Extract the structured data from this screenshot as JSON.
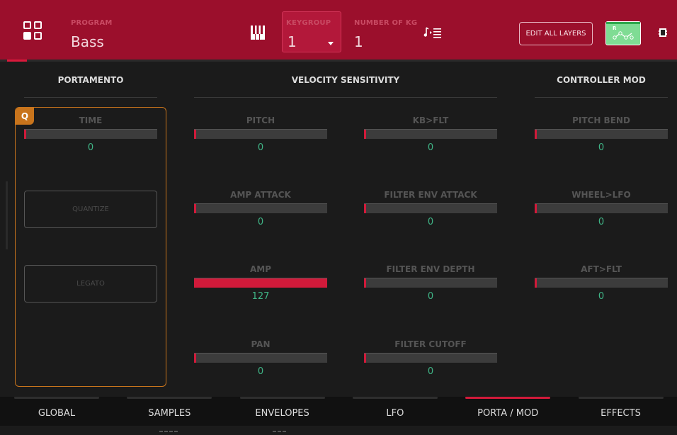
{
  "header": {
    "program_label": "PROGRAM",
    "program_value": "Bass",
    "keygroup_label": "KEYGROUP",
    "keygroup_value": "1",
    "number_of_kg_label": "NUMBER OF KG",
    "number_of_kg_value": "1",
    "edit_all_layers": "EDIT ALL LAYERS",
    "mod_matrix_letter": "R"
  },
  "sections": {
    "portamento": "PORTAMENTO",
    "velocity": "VELOCITY SENSITIVITY",
    "controller": "CONTROLLER MOD"
  },
  "portamento": {
    "q_badge": "Q",
    "time_label": "TIME",
    "time_value": "0",
    "quantize": "QUANTIZE",
    "legato": "LEGATO"
  },
  "params": [
    {
      "label": "PITCH",
      "value": "0",
      "level": 0
    },
    {
      "label": "AMP ATTACK",
      "value": "0",
      "level": 0
    },
    {
      "label": "AMP",
      "value": "127",
      "level": 1
    },
    {
      "label": "PAN",
      "value": "0",
      "level": 0
    },
    {
      "label": "KB>FLT",
      "value": "0",
      "level": 0
    },
    {
      "label": "FILTER ENV ATTACK",
      "value": "0",
      "level": 0
    },
    {
      "label": "FILTER ENV DEPTH",
      "value": "0",
      "level": 0
    },
    {
      "label": "FILTER CUTOFF",
      "value": "0",
      "level": 0
    },
    {
      "label": "PITCH BEND",
      "value": "0",
      "level": 0
    },
    {
      "label": "WHEEL>LFO",
      "value": "0",
      "level": 0
    },
    {
      "label": "AFT>FLT",
      "value": "0",
      "level": 0
    }
  ],
  "tabs": [
    {
      "label": "GLOBAL",
      "active": false
    },
    {
      "label": "SAMPLES",
      "active": false
    },
    {
      "label": "ENVELOPES",
      "active": false
    },
    {
      "label": "LFO",
      "active": false
    },
    {
      "label": "PORTA / MOD",
      "active": true
    },
    {
      "label": "EFFECTS",
      "active": false
    }
  ],
  "colors": {
    "accent": "#d11a3a",
    "header": "#9b0f2c",
    "value_green": "#3fb586",
    "quantize_orange": "#c8741c",
    "mod_green": "#7fdc94"
  },
  "icons": [
    "grid-icon",
    "keyboard-icon",
    "dropdown-arrow-icon",
    "note-list-icon",
    "mod-matrix-icon",
    "battery-icon"
  ]
}
